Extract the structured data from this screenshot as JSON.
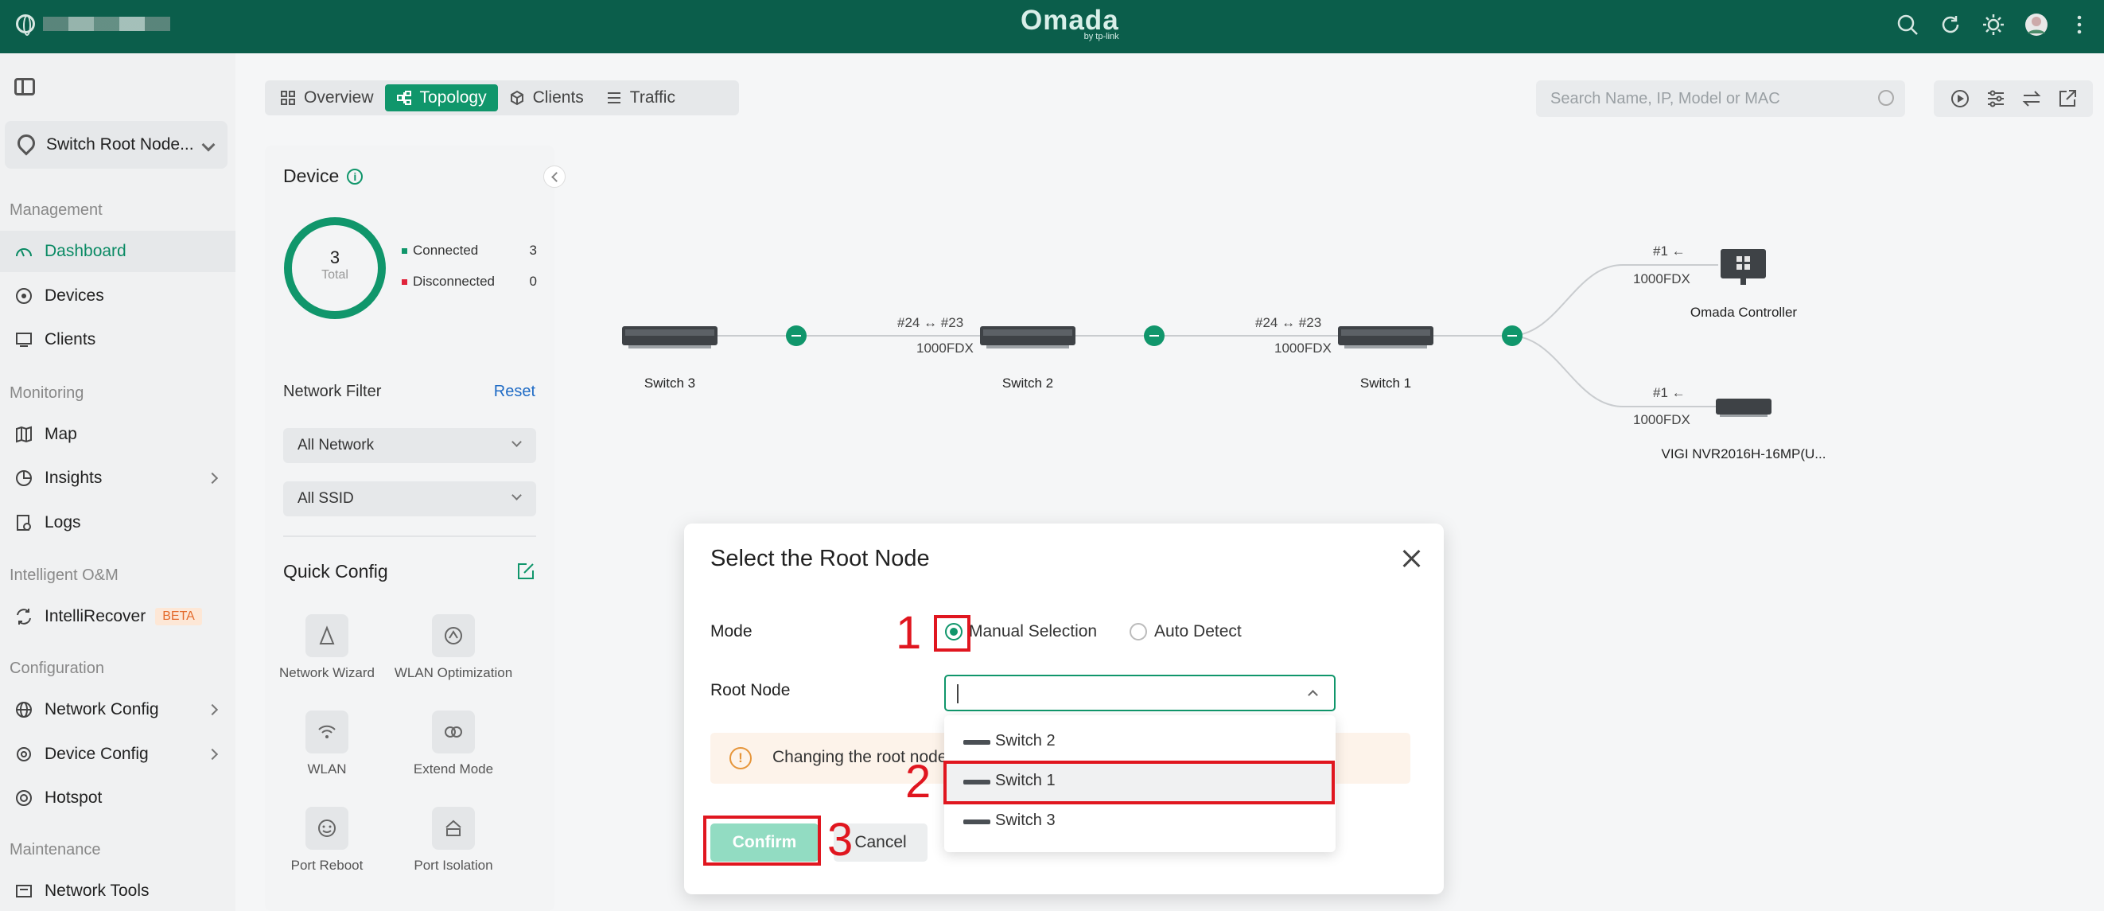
{
  "topbar": {
    "logo": "Omada",
    "logo_sub": "by tp-link",
    "icons": [
      "search-icon",
      "refresh-icon",
      "theme-sun-icon",
      "avatar",
      "more-icon"
    ]
  },
  "sidebar": {
    "site": "Switch Root Node...",
    "sections": {
      "management": "Management",
      "monitoring": "Monitoring",
      "intelligent": "Intelligent O&M",
      "configuration": "Configuration",
      "maintenance": "Maintenance"
    },
    "items": {
      "dashboard": "Dashboard",
      "devices": "Devices",
      "clients": "Clients",
      "map": "Map",
      "insights": "Insights",
      "logs": "Logs",
      "intellirecover": "IntelliRecover",
      "beta": "BETA",
      "network_config": "Network Config",
      "device_config": "Device Config",
      "hotspot": "Hotspot",
      "network_tools": "Network Tools"
    }
  },
  "tabs": [
    "Overview",
    "Topology",
    "Clients",
    "Traffic"
  ],
  "search": {
    "placeholder": "Search Name, IP, Model or MAC"
  },
  "panel": {
    "device_title": "Device",
    "total": "3",
    "total_label": "Total",
    "connected_label": "Connected",
    "connected": "3",
    "disconnected_label": "Disconnected",
    "disconnected": "0",
    "network_filter": "Network Filter",
    "reset": "Reset",
    "all_network": "All Network",
    "all_ssid": "All SSID",
    "quick_config": "Quick Config",
    "qc_items": [
      "Network Wizard",
      "WLAN Optimization",
      "WLAN",
      "Extend Mode",
      "Port Reboot",
      "Port Isolation"
    ]
  },
  "topology": {
    "switch3": "Switch 3",
    "switch2": "Switch 2",
    "switch1": "Switch 1",
    "controller": "Omada Controller",
    "nvr": "VIGI NVR2016H-16MP(U...",
    "link_a_ports": "#24 ↔ #23",
    "link_a_speed": "1000FDX",
    "link_b_ports": "#24 ↔ #23",
    "link_b_speed": "1000FDX",
    "link_c_ports": "#1 ←",
    "link_c_speed": "1000FDX",
    "link_d_ports": "#1 ←",
    "link_d_speed": "1000FDX"
  },
  "dialog": {
    "title": "Select the Root Node",
    "mode_label": "Mode",
    "manual": "Manual Selection",
    "auto": "Auto Detect",
    "root_label": "Root Node",
    "warning": "Changing the root node",
    "confirm": "Confirm",
    "cancel": "Cancel",
    "options": [
      "Switch 2",
      "Switch 1",
      "Switch 3"
    ]
  },
  "annotations": {
    "one": "1",
    "two": "2",
    "three": "3"
  }
}
